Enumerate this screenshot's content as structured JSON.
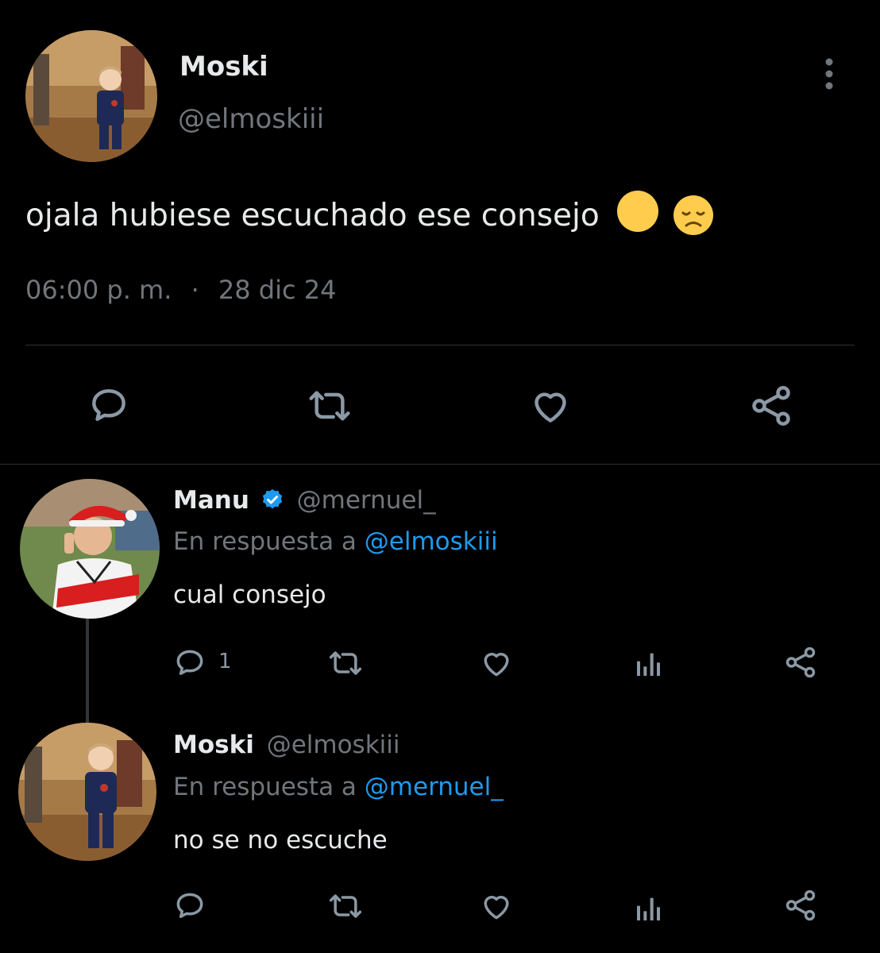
{
  "main_tweet": {
    "author_name": "Moski",
    "author_handle": "@elmoskiii",
    "text": "ojala hubiese escuchado ese consejo",
    "emoji": "😞",
    "time": "06:00 p. m.",
    "separator": "·",
    "date": "28 dic 24"
  },
  "reply1": {
    "author_name": "Manu",
    "author_handle": "@mernuel_",
    "reply_prefix": "En respuesta a",
    "reply_to": "@elmoskiii",
    "text": "cual consejo",
    "reply_count": "1"
  },
  "reply2": {
    "author_name": "Moski",
    "author_handle": "@elmoskiii",
    "reply_prefix": "En respuesta a",
    "reply_to": "@mernuel_",
    "text": "no se no escuche"
  },
  "colors": {
    "background": "#000000",
    "text": "#e7e9ea",
    "muted": "#71767b",
    "accent": "#1d9bf0",
    "divider": "#2f3336"
  }
}
